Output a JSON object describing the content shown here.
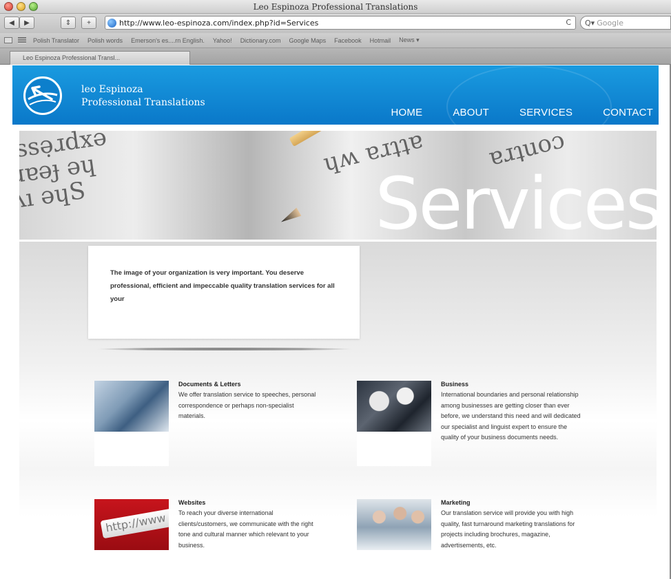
{
  "browser": {
    "window_title": "Leo Espinoza Professional Translations",
    "url": "http://www.leo-espinoza.com/index.php?id=Services",
    "search_placeholder": "Google",
    "bookmarks": [
      "Polish Translator",
      "Polish words",
      "Emerson's es....rn English.",
      "Yahoo!",
      "Dictionary.com",
      "Google Maps",
      "Facebook",
      "Hotmail",
      "News ▾"
    ],
    "tab_label": "Leo Espinoza Professional Transl..."
  },
  "site": {
    "logo_line1": "leo Espinoza",
    "logo_line2": "Professional Translations",
    "nav": [
      "HOME",
      "ABOUT",
      "SERVICES",
      "CONTACT"
    ],
    "hero_title": "Services",
    "intro_text": "The image of your organization is very important. You deserve professional, efficient and impeccable quality translation services for all your",
    "services": [
      {
        "title": "Documents & Letters",
        "description": "We offer translation service to speeches, personal correspondence or perhaps non-specialist materials.",
        "image": "documents-photo"
      },
      {
        "title": "Business",
        "description": "International boundaries and personal relationship among businesses are getting closer than ever before, we understand this need and will dedicated our specialist and linguist expert to ensure the quality of your business documents needs.",
        "image": "business-meeting-photo"
      },
      {
        "title": "Websites",
        "description": "To reach your diverse international clients/customers, we communicate with the right tone and cultural manner which relevant to your business.",
        "image": "http-address-photo"
      },
      {
        "title": "Marketing",
        "description": "Our translation service will provide you with high quality, fast turnaround marketing translations for projects including brochures, magazine, advertisements, etc.",
        "image": "marketing-team-photo"
      }
    ],
    "colors": {
      "header_blue": "#0a78c9",
      "nav_text": "#ffffff"
    }
  }
}
